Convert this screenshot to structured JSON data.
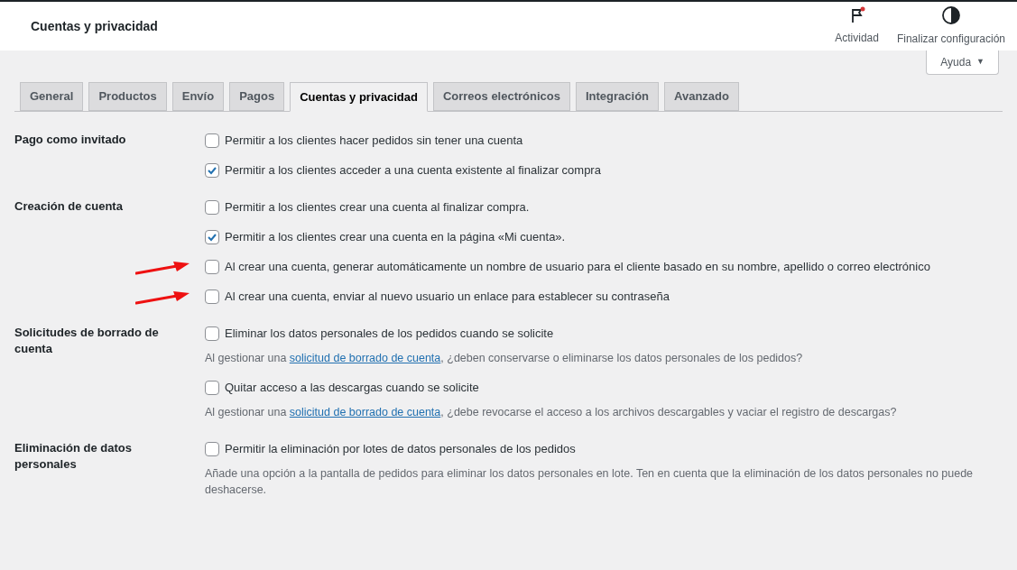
{
  "header": {
    "title": "Cuentas y privacidad",
    "actions": [
      {
        "kind": "activity",
        "label": "Actividad",
        "notification": true
      },
      {
        "kind": "setup",
        "label": "Finalizar configuración"
      }
    ]
  },
  "help_button": {
    "label": "Ayuda",
    "caret": "▼"
  },
  "tabs": [
    {
      "label": "General",
      "selected": false
    },
    {
      "label": "Productos",
      "selected": false
    },
    {
      "label": "Envío",
      "selected": false
    },
    {
      "label": "Pagos",
      "selected": false
    },
    {
      "label": "Cuentas y privacidad",
      "selected": true
    },
    {
      "label": "Correos electrónicos",
      "selected": false
    },
    {
      "label": "Integración",
      "selected": false
    },
    {
      "label": "Avanzado",
      "selected": false
    }
  ],
  "sections": [
    {
      "label": "Pago como invitado",
      "options": [
        {
          "label": "Permitir a los clientes hacer pedidos sin tener una cuenta",
          "checked": false
        },
        {
          "label": "Permitir a los clientes acceder a una cuenta existente al finalizar compra",
          "checked": true
        }
      ]
    },
    {
      "label": "Creación de cuenta",
      "options": [
        {
          "label": "Permitir a los clientes crear una cuenta al finalizar compra.",
          "checked": false
        },
        {
          "label": "Permitir a los clientes crear una cuenta en la página «Mi cuenta».",
          "checked": true
        },
        {
          "label": "Al crear una cuenta, generar automáticamente un nombre de usuario para el cliente basado en su nombre, apellido o correo electrónico",
          "checked": false,
          "annotated": true
        },
        {
          "label": "Al crear una cuenta, enviar al nuevo usuario un enlace para establecer su contraseña",
          "checked": false,
          "annotated": true
        }
      ]
    },
    {
      "label": "Solicitudes de borrado de cuenta",
      "options": [
        {
          "label": "Eliminar los datos personales de los pedidos cuando se solicite",
          "checked": false,
          "description": {
            "before": "Al gestionar una ",
            "link": "solicitud de borrado de cuenta",
            "after": ", ¿deben conservarse o eliminarse los datos personales de los pedidos?"
          }
        },
        {
          "label": "Quitar acceso a las descargas cuando se solicite",
          "checked": false,
          "description": {
            "before": "Al gestionar una ",
            "link": "solicitud de borrado de cuenta",
            "after": ", ¿debe revocarse el acceso a los archivos descargables y vaciar el registro de descargas?"
          }
        }
      ]
    },
    {
      "label": "Eliminación de datos personales",
      "options": [
        {
          "label": "Permitir la eliminación por lotes de datos personales de los pedidos",
          "checked": false,
          "description": {
            "before": "Añade una opción a la pantalla de pedidos para eliminar los datos personales en lote. Ten en cuenta que la eliminación de los datos personales no puede deshacerse."
          }
        }
      ]
    }
  ]
}
